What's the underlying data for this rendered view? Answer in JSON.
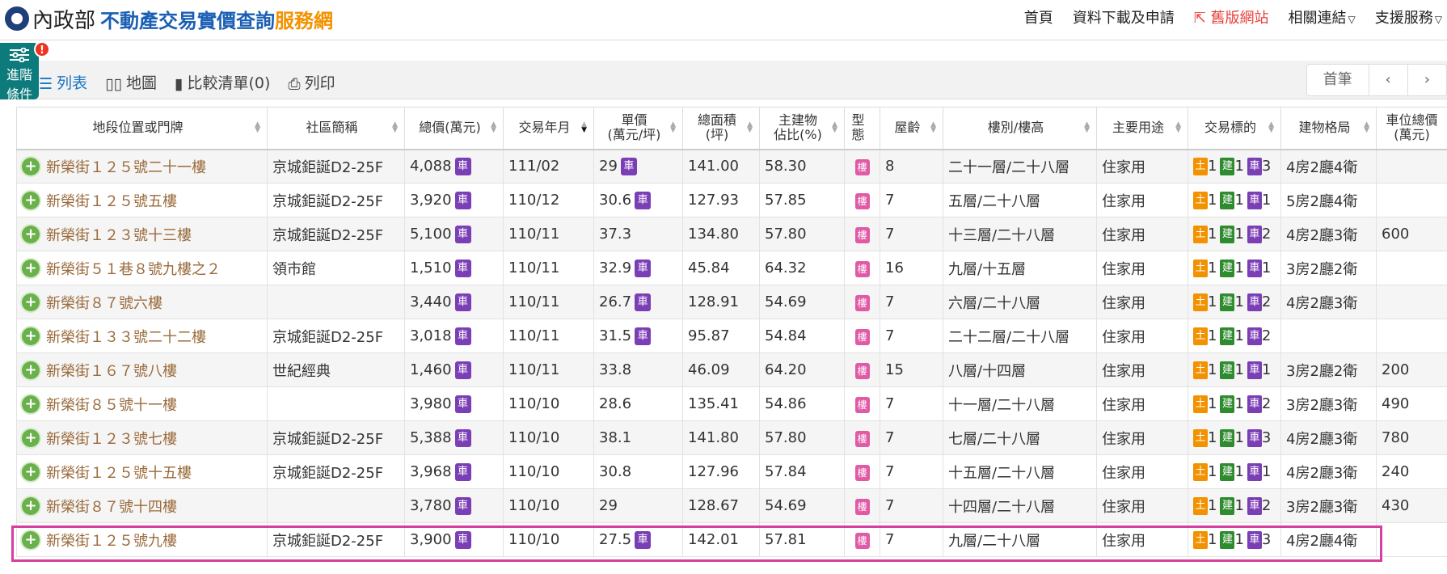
{
  "header": {
    "logo_moi": "內政部",
    "logo_title1": "不動產交易實價查詢",
    "logo_title2": "服務網",
    "nav": [
      "首頁",
      "資料下載及申請",
      "舊版網站",
      "相關連結",
      "支援服務"
    ]
  },
  "filter": {
    "label1": "進階",
    "label2": "條件",
    "badge": "!"
  },
  "toolbar": {
    "list": "列表",
    "map": "地圖",
    "compare": "比較清單(0)",
    "print": "列印"
  },
  "pager": {
    "first": "首筆",
    "prev": "‹",
    "next": "›"
  },
  "columns": [
    "地段位置或門牌",
    "社區簡稱",
    "總價(萬元)",
    "交易年月",
    "單價\n(萬元/坪)",
    "總面積\n(坪)",
    "主建物\n佔比(%)",
    "型態",
    "屋齡",
    "樓別/樓高",
    "主要用途",
    "交易標的",
    "建物格局",
    "車位總價\n(萬元)"
  ],
  "labels": {
    "car": "車",
    "lou": "樓",
    "land": "土",
    "bld": "建",
    "park": "車"
  },
  "rows": [
    {
      "addr": "新榮街１２５號二十一樓",
      "community": "京城鉅誕D2-25F",
      "price": "4,088",
      "pcar": true,
      "date": "111/02",
      "unit": "29",
      "ucar": true,
      "area": "141.00",
      "ratio": "58.30",
      "age": "8",
      "floor": "二十一層/二十八層",
      "use": "住家用",
      "t": [
        "1",
        "1",
        "3"
      ],
      "layout": "4房2廳4衛",
      "parking": ""
    },
    {
      "addr": "新榮街１２５號五樓",
      "community": "京城鉅誕D2-25F",
      "price": "3,920",
      "pcar": true,
      "date": "110/12",
      "unit": "30.6",
      "ucar": true,
      "area": "127.93",
      "ratio": "57.85",
      "age": "7",
      "floor": "五層/二十八層",
      "use": "住家用",
      "t": [
        "1",
        "1",
        "1"
      ],
      "layout": "5房2廳4衛",
      "parking": ""
    },
    {
      "addr": "新榮街１２３號十三樓",
      "community": "京城鉅誕D2-25F",
      "price": "5,100",
      "pcar": true,
      "date": "110/11",
      "unit": "37.3",
      "ucar": false,
      "area": "134.80",
      "ratio": "57.80",
      "age": "7",
      "floor": "十三層/二十八層",
      "use": "住家用",
      "t": [
        "1",
        "1",
        "2"
      ],
      "layout": "4房2廳3衛",
      "parking": "600"
    },
    {
      "addr": "新榮街５１巷８號九樓之２",
      "community": "領市館",
      "price": "1,510",
      "pcar": true,
      "date": "110/11",
      "unit": "32.9",
      "ucar": true,
      "area": "45.84",
      "ratio": "64.32",
      "age": "16",
      "floor": "九層/十五層",
      "use": "住家用",
      "t": [
        "1",
        "1",
        "1"
      ],
      "layout": "3房2廳2衛",
      "parking": ""
    },
    {
      "addr": "新榮街８７號六樓",
      "community": "",
      "price": "3,440",
      "pcar": true,
      "date": "110/11",
      "unit": "26.7",
      "ucar": true,
      "area": "128.91",
      "ratio": "54.69",
      "age": "7",
      "floor": "六層/二十八層",
      "use": "住家用",
      "t": [
        "1",
        "1",
        "2"
      ],
      "layout": "4房2廳3衛",
      "parking": ""
    },
    {
      "addr": "新榮街１３３號二十二樓",
      "community": "京城鉅誕D2-25F",
      "price": "3,018",
      "pcar": true,
      "date": "110/11",
      "unit": "31.5",
      "ucar": true,
      "area": "95.87",
      "ratio": "54.84",
      "age": "7",
      "floor": "二十二層/二十八層",
      "use": "住家用",
      "t": [
        "1",
        "1",
        "2"
      ],
      "layout": "",
      "parking": ""
    },
    {
      "addr": "新榮街１６７號八樓",
      "community": "世紀經典",
      "price": "1,460",
      "pcar": true,
      "date": "110/11",
      "unit": "33.8",
      "ucar": false,
      "area": "46.09",
      "ratio": "64.20",
      "age": "15",
      "floor": "八層/十四層",
      "use": "住家用",
      "t": [
        "1",
        "1",
        "1"
      ],
      "layout": "3房2廳2衛",
      "parking": "200"
    },
    {
      "addr": "新榮街８５號十一樓",
      "community": "",
      "price": "3,980",
      "pcar": true,
      "date": "110/10",
      "unit": "28.6",
      "ucar": false,
      "area": "135.41",
      "ratio": "54.86",
      "age": "7",
      "floor": "十一層/二十八層",
      "use": "住家用",
      "t": [
        "1",
        "1",
        "2"
      ],
      "layout": "3房2廳3衛",
      "parking": "490"
    },
    {
      "addr": "新榮街１２３號七樓",
      "community": "京城鉅誕D2-25F",
      "price": "5,388",
      "pcar": true,
      "date": "110/10",
      "unit": "38.1",
      "ucar": false,
      "area": "141.80",
      "ratio": "57.80",
      "age": "7",
      "floor": "七層/二十八層",
      "use": "住家用",
      "t": [
        "1",
        "1",
        "3"
      ],
      "layout": "4房2廳3衛",
      "parking": "780"
    },
    {
      "addr": "新榮街１２５號十五樓",
      "community": "京城鉅誕D2-25F",
      "price": "3,968",
      "pcar": true,
      "date": "110/10",
      "unit": "30.8",
      "ucar": false,
      "area": "127.96",
      "ratio": "57.84",
      "age": "7",
      "floor": "十五層/二十八層",
      "use": "住家用",
      "t": [
        "1",
        "1",
        "1"
      ],
      "layout": "4房2廳3衛",
      "parking": "240"
    },
    {
      "addr": "新榮街８７號十四樓",
      "community": "",
      "price": "3,780",
      "pcar": true,
      "date": "110/10",
      "unit": "29",
      "ucar": false,
      "area": "128.67",
      "ratio": "54.69",
      "age": "7",
      "floor": "十四層/二十八層",
      "use": "住家用",
      "t": [
        "1",
        "1",
        "2"
      ],
      "layout": "3房2廳3衛",
      "parking": "430"
    },
    {
      "addr": "新榮街１２５號九樓",
      "community": "京城鉅誕D2-25F",
      "price": "3,900",
      "pcar": true,
      "date": "110/10",
      "unit": "27.5",
      "ucar": true,
      "area": "142.01",
      "ratio": "57.81",
      "age": "7",
      "floor": "九層/二十八層",
      "use": "住家用",
      "t": [
        "1",
        "1",
        "3"
      ],
      "layout": "4房2廳4衛",
      "parking": ""
    }
  ]
}
